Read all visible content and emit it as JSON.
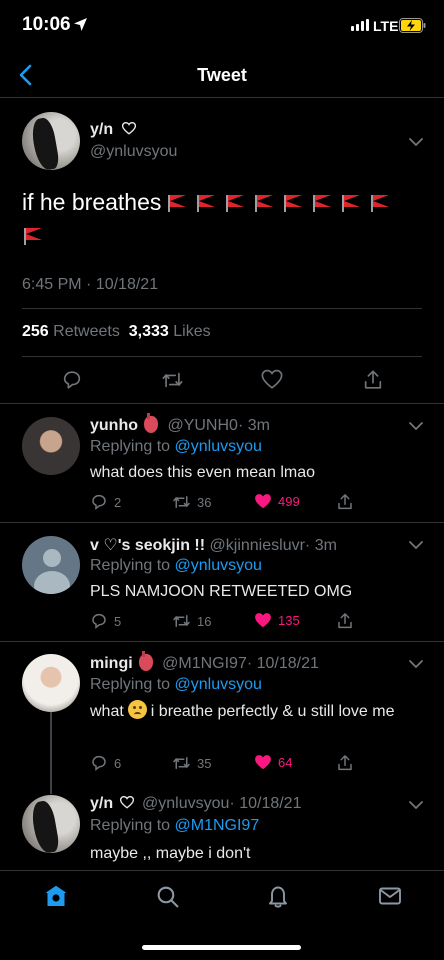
{
  "status_bar": {
    "time": "10:06",
    "network": "LTE"
  },
  "header": {
    "title": "Tweet"
  },
  "main_tweet": {
    "name": "y/n",
    "handle": "@ynluvsyou",
    "text": "if he breathes",
    "flag_count": 9,
    "timestamp": "6:45 PM · 10/18/21",
    "retweets_count": "256",
    "retweets_label": "Retweets",
    "likes_count": "3,333",
    "likes_label": "Likes"
  },
  "replies": [
    {
      "name": "yunho",
      "handle": "@YUNH0",
      "time": "· 3m",
      "replying_label": "Replying to",
      "replying_to": "@ynluvsyou",
      "text": "what does this even mean lmao",
      "replies": "2",
      "retweets": "36",
      "likes": "499"
    },
    {
      "name": "v ♡'s seokjin !!",
      "handle": "@kjinniesluvr",
      "time": "· 3m",
      "replying_label": "Replying to",
      "replying_to": "@ynluvsyou",
      "text": "PLS NAMJOON RETWEETED OMG",
      "replies": "5",
      "retweets": "16",
      "likes": "135"
    },
    {
      "name": "mingi",
      "handle": "@M1NGI97",
      "time": "· 10/18/21",
      "replying_label": "Replying to",
      "replying_to": "@ynluvsyou",
      "text_before_emoji": "what",
      "text_after_emoji": "i breathe perfectly & u still love me",
      "replies": "6",
      "retweets": "35",
      "likes": "64"
    },
    {
      "name": "y/n",
      "handle": "@ynluvsyou",
      "time": "· 10/18/21",
      "replying_label": "Replying to",
      "replying_to": "@M1NGI97",
      "text": "maybe ,, maybe i don't"
    }
  ],
  "colors": {
    "accent": "#1d9bf0",
    "like": "#f91880",
    "muted": "#71767b",
    "background": "#000000"
  }
}
